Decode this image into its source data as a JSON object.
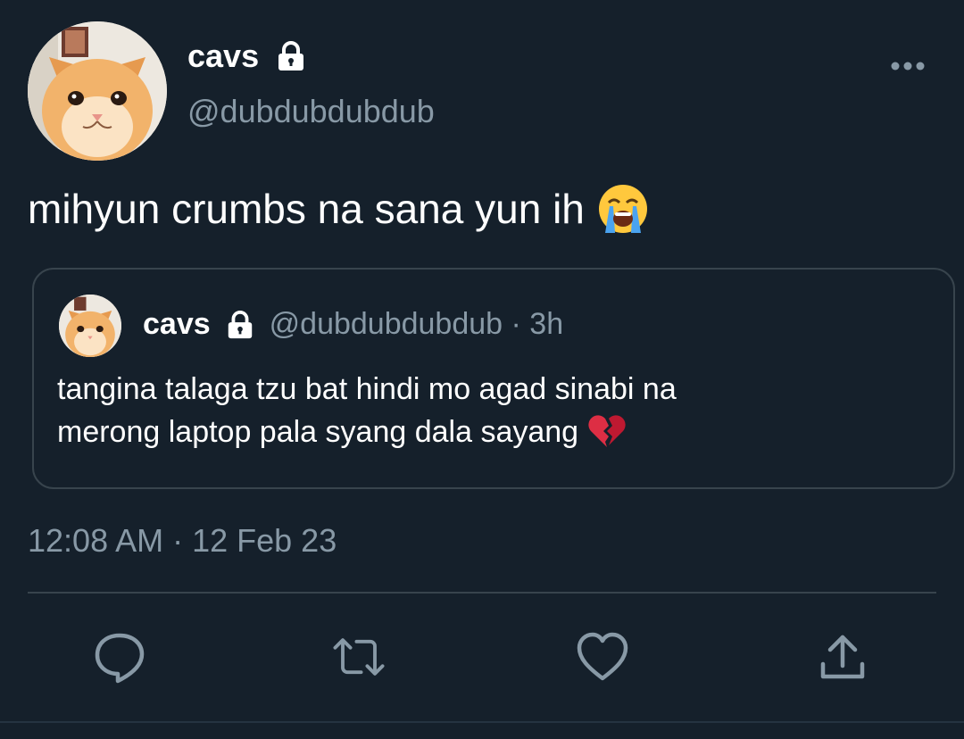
{
  "tweet": {
    "display_name": "cavs",
    "handle": "@dubdubdubdub",
    "text": "mihyun crumbs na sana yun ih",
    "timestamp": "12:08 AM · 12 Feb 23",
    "emoji": "loudly-crying-face"
  },
  "quoted": {
    "display_name": "cavs",
    "meta": "@dubdubdubdub · 3h",
    "line1": "tangina talaga tzu bat hindi mo agad sinabi na",
    "line2": "merong laptop pala syang dala sayang",
    "emoji": "broken-heart"
  },
  "actions": [
    "reply-icon",
    "retweet-icon",
    "like-icon",
    "share-icon"
  ],
  "colors": {
    "background": "#15202b",
    "secondary_text": "#8899a6",
    "border": "#38444d",
    "icon": "#8899a6",
    "text": "#ffffff"
  }
}
